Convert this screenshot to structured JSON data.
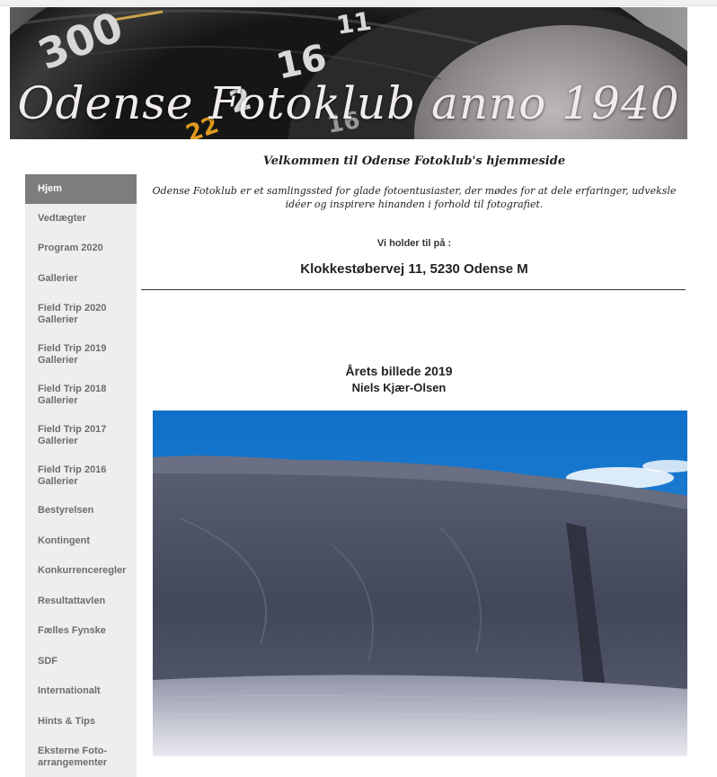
{
  "banner": {
    "title": "Odense Fotoklub anno 1940",
    "dial_numbers": [
      "300",
      "16",
      "11",
      "2",
      "16",
      "22"
    ]
  },
  "nav": {
    "items": [
      {
        "label": "Hjem",
        "active": true
      },
      {
        "label": "Vedtægter"
      },
      {
        "label": "Program 2020"
      },
      {
        "label": "Gallerier"
      },
      {
        "label": "Field Trip 2020 Gallerier"
      },
      {
        "label": "Field Trip 2019 Gallerier"
      },
      {
        "label": "Field Trip 2018 Gallerier"
      },
      {
        "label": "Field Trip 2017 Gallerier"
      },
      {
        "label": "Field Trip 2016 Gallerier"
      },
      {
        "label": "Bestyrelsen"
      },
      {
        "label": "Kontingent"
      },
      {
        "label": "Konkurrenceregler"
      },
      {
        "label": "Resultattavlen"
      },
      {
        "label": "Fælles Fynske"
      },
      {
        "label": "SDF"
      },
      {
        "label": "Internationalt"
      },
      {
        "label": "Hints & Tips"
      },
      {
        "label": "Eksterne Foto-arrangementer"
      }
    ]
  },
  "content": {
    "welcome": "Velkommen til Odense Fotoklub's hjemmeside",
    "intro": "Odense Fotoklub er et samlingssted for glade fotoentusiaster, der mødes for at dele erfaringer, udveksle idéer og inspirere hinanden i forhold til fotografiet.",
    "venue_label": "Vi holder til på :",
    "venue_address": "Klokkestøbervej 11, 5230 Odense M",
    "photo_title": "Årets billede 2019",
    "photo_author": "Niels Kjær-Olsen"
  },
  "colors": {
    "nav_background": "#eeeeee",
    "nav_active": "#7d7d7d",
    "nav_text": "#6d6d6d",
    "sky": "#1f7fd0",
    "dune": "#4a4d5e"
  }
}
